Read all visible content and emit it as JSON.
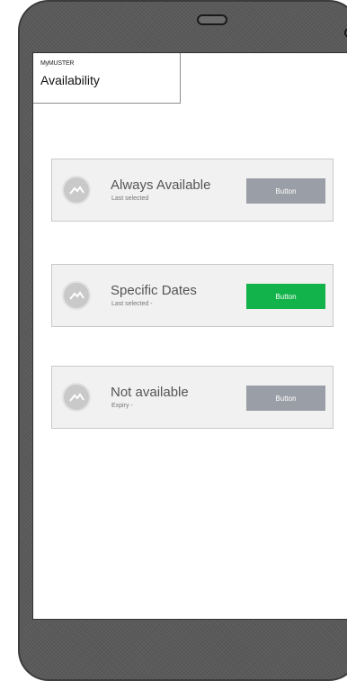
{
  "app": {
    "name": "MyMUSTER"
  },
  "page": {
    "title": "Availability"
  },
  "options": [
    {
      "title": "Always Available",
      "subtitle": "Last selected",
      "button_label": "Button",
      "button_color": "#9a9ea6"
    },
    {
      "title": "Specific Dates",
      "subtitle": "Last selected -",
      "button_label": "Button",
      "button_color": "#12b34a"
    },
    {
      "title": "Not available",
      "subtitle": "Expiry -",
      "button_label": "Button",
      "button_color": "#9a9ea6"
    }
  ],
  "icons": {
    "option_icon": "mountain-avatar-icon"
  },
  "colors": {
    "active_button": "#12b34a",
    "inactive_button": "#9a9ea6",
    "device_frame": "#5a5a5a"
  }
}
